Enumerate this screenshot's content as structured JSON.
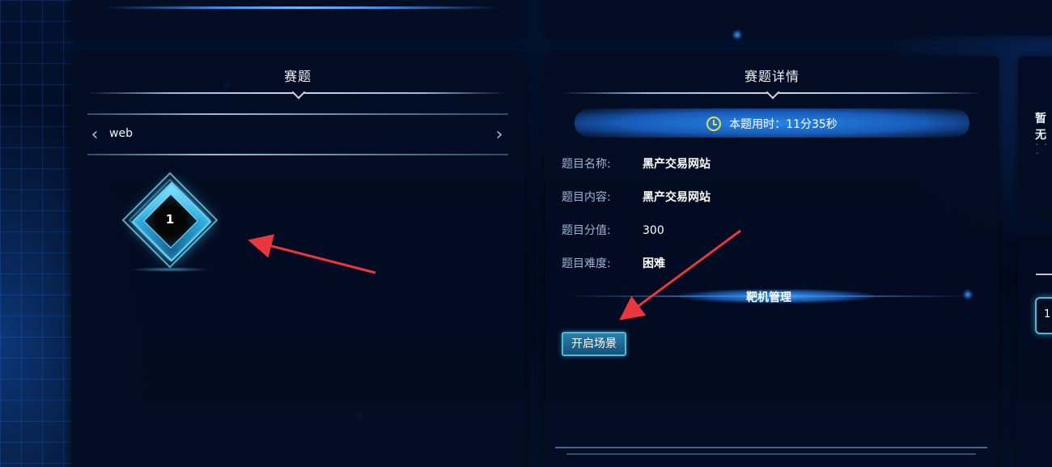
{
  "challenge_panel": {
    "title": "赛题",
    "category": {
      "label": "web",
      "prev_icon": "chevron-left-icon",
      "next_icon": "chevron-right-icon"
    },
    "challenges": [
      {
        "number": "1"
      }
    ]
  },
  "detail_panel": {
    "title": "赛题详情",
    "timer": {
      "icon": "clock-icon",
      "text": "本题用时：11分35秒"
    },
    "fields": [
      {
        "label": "题目名称:",
        "value": "黑产交易网站"
      },
      {
        "label": "题目内容:",
        "value": "黑产交易网站"
      },
      {
        "label": "题目分值:",
        "value": "300"
      },
      {
        "label": "题目难度:",
        "value": "困难"
      }
    ],
    "section_title": "靶机管理",
    "start_button": "开启场景"
  },
  "right_panel": {
    "partial_text": "暂无",
    "dots": "· · · · ·",
    "chip_text": "1"
  },
  "colors": {
    "background": "#020a1e",
    "accent": "#4fb8d8",
    "timer_icon": "#e8e04a",
    "annotation_arrow": "#e8383d"
  }
}
